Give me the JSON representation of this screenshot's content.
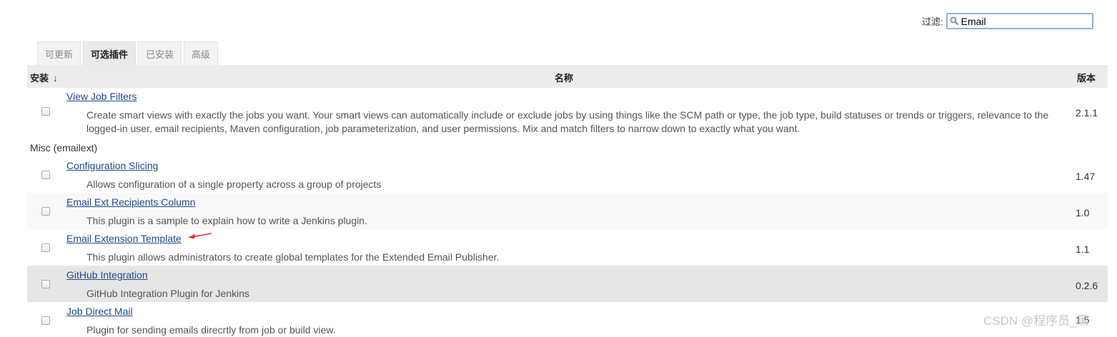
{
  "filter": {
    "label": "过滤:",
    "value": "Email"
  },
  "tabs": [
    "可更新",
    "可选插件",
    "已安装",
    "高级"
  ],
  "table": {
    "headers": {
      "install": "安装",
      "sort_indicator": "↓",
      "name": "名称",
      "version": "版本"
    },
    "category": "Misc (emailext)",
    "plugins": [
      {
        "name": "View Job Filters",
        "description": "Create smart views with exactly the jobs you want. Your smart views can automatically include or exclude jobs by using things like the SCM path or type, the job type, build statuses or trends or triggers, relevance to the logged-in user, email recipients, Maven configuration, job parameterization, and user permissions. Mix and match filters to narrow down to exactly what you want.",
        "version": "2.1.1"
      },
      {
        "name": "Configuration Slicing",
        "description": "Allows configuration of a single property across a group of projects",
        "version": "1.47"
      },
      {
        "name": "Email Ext Recipients Column",
        "description": "This plugin is a sample to explain how to write a Jenkins plugin.",
        "version": "1.0"
      },
      {
        "name": "Email Extension Template",
        "description": "This plugin allows administrators to create global templates for the Extended Email Publisher.",
        "version": "1.1"
      },
      {
        "name": "GitHub Integration",
        "description": "GitHub Integration Plugin for Jenkins",
        "version": "0.2.6"
      },
      {
        "name": "Job Direct Mail",
        "description": "Plugin for sending emails direcrtly from job or build view.",
        "version": "1.5"
      }
    ]
  },
  "watermark": "CSDN @程序员_黑",
  "annotation_color": "#e8302f"
}
